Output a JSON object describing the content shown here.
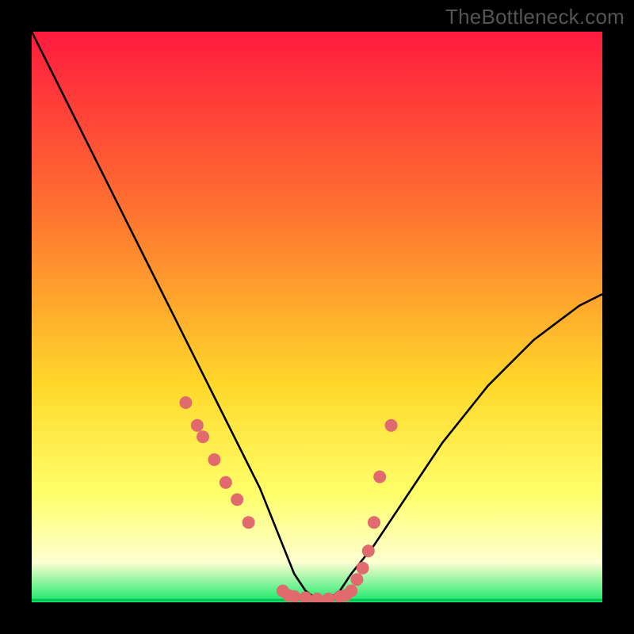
{
  "watermark": "TheBottleneck.com",
  "colors": {
    "frame": "#000000",
    "curve": "#000000",
    "dot": "#e06a6e",
    "gradient_top": "#ff1a3e",
    "gradient_mid1": "#ff7a2f",
    "gradient_mid2": "#ffd82a",
    "gradient_mid3": "#ffff6a",
    "gradient_mid4": "#fdffd0",
    "gradient_bottom": "#17e86a",
    "line_green": "#00c45a"
  },
  "chart_data": {
    "type": "line",
    "title": "",
    "xlabel": "",
    "ylabel": "",
    "xlim": [
      0,
      100
    ],
    "ylim": [
      0,
      100
    ],
    "series": [
      {
        "name": "bottleneck-curve",
        "x": [
          0,
          4,
          8,
          12,
          16,
          20,
          24,
          28,
          32,
          36,
          40,
          44,
          46,
          48,
          50,
          52,
          54,
          56,
          60,
          64,
          68,
          72,
          76,
          80,
          84,
          88,
          92,
          96,
          100
        ],
        "y": [
          100,
          92,
          84,
          76,
          68,
          60,
          52,
          44,
          36,
          28,
          20,
          10,
          5,
          2,
          0.5,
          0.5,
          2,
          5,
          10,
          16,
          22,
          28,
          33,
          38,
          42,
          46,
          49,
          52,
          54
        ]
      }
    ],
    "dots": {
      "name": "sample-points",
      "x": [
        27,
        29,
        30,
        32,
        34,
        36,
        38,
        44,
        45,
        46,
        48,
        50,
        52,
        54,
        55,
        56,
        57,
        58,
        59,
        60,
        61,
        63
      ],
      "y": [
        35,
        31,
        29,
        25,
        21,
        18,
        14,
        2,
        1.2,
        1,
        0.8,
        0.6,
        0.6,
        1,
        1.2,
        2,
        4,
        6,
        9,
        14,
        22,
        31
      ]
    },
    "bands": [
      {
        "name": "green-line",
        "y": 0.4
      }
    ]
  }
}
